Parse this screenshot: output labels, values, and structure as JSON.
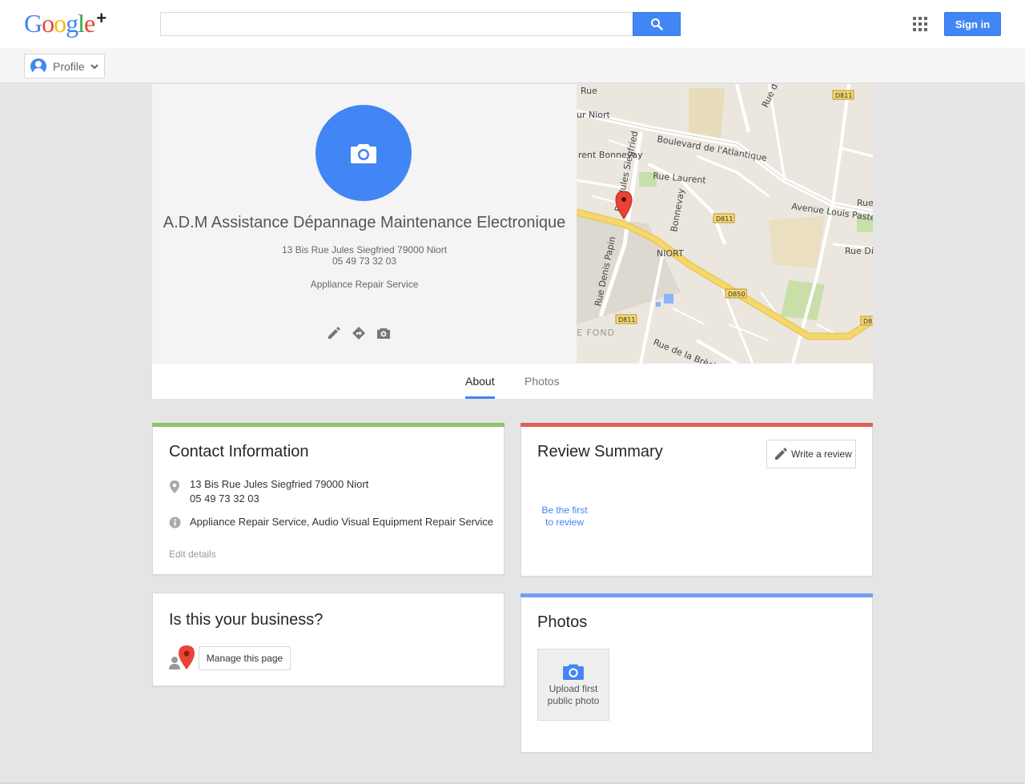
{
  "header": {
    "logo_text": "Google",
    "logo_plus": "+",
    "search_value": "",
    "signin_label": "Sign in"
  },
  "subbar": {
    "profile_label": "Profile"
  },
  "business": {
    "name": "A.D.M Assistance Dépannage Maintenance Electronique",
    "address": "13 Bis Rue Jules Siegfried 79000 Niort",
    "phone": "05 49 73 32 03",
    "category": "Appliance Repair Service"
  },
  "map": {
    "labels": [
      "Boulevard de l'Atlantique",
      "Avenue Louis Paste",
      "Rue Denis Papin",
      "NIORT",
      "D811",
      "D850",
      "Rue Laurent Bonnevay",
      "rent Bonnevay",
      "ur Niort",
      "Rue de la Brèche",
      "E FOND",
      "Rue Dil",
      "Rue du"
    ],
    "road_major_color": "#f5d76e",
    "park_color": "#c8dfaa"
  },
  "tabs": [
    {
      "label": "About",
      "active": true
    },
    {
      "label": "Photos",
      "active": false
    }
  ],
  "contact": {
    "title": "Contact Information",
    "address": "13 Bis Rue Jules Siegfried 79000 Niort",
    "phone": "05 49 73 32 03",
    "categories": "Appliance Repair Service, Audio Visual Equipment Repair Service",
    "edit_label": "Edit details",
    "accent": "#8bc56b"
  },
  "review": {
    "title": "Review Summary",
    "write_label": "Write a review",
    "first_line1": "Be the first",
    "first_line2": "to review",
    "accent": "#e06055"
  },
  "business_claim": {
    "title": "Is this your business?",
    "manage_label": "Manage this page"
  },
  "photos": {
    "title": "Photos",
    "upload_line1": "Upload first",
    "upload_line2": "public photo",
    "accent": "#6f9ff5"
  }
}
